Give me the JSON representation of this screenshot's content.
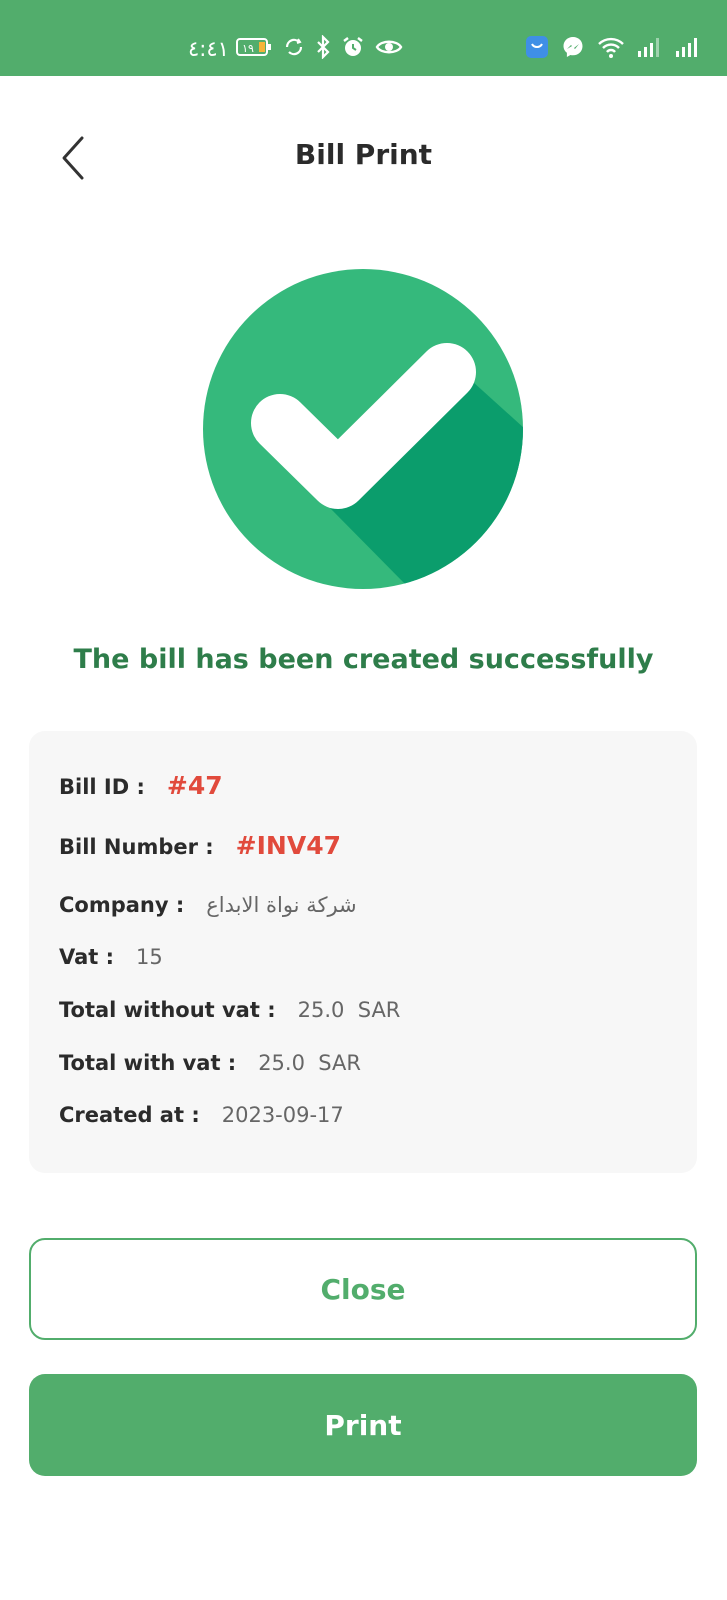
{
  "status_bar": {
    "time": "٤:٤١",
    "battery_level": "١٩",
    "icons_left": [
      "battery-icon",
      "sync-icon",
      "bluetooth-icon",
      "alarm-icon",
      "eye-icon"
    ],
    "icons_right": [
      "app-icon",
      "messenger-icon",
      "wifi-icon",
      "signal-icon",
      "signal-icon"
    ],
    "background_color": "#52ad6c"
  },
  "header": {
    "title": "Bill Print",
    "back_icon": "chevron-left-icon"
  },
  "success": {
    "icon": "check-circle-icon",
    "message": "The bill has been created successfully",
    "icon_color": "#35b97c",
    "icon_shadow_color": "#0b9d6c"
  },
  "details": {
    "bill_id": {
      "label": "Bill ID :",
      "value": "#47"
    },
    "bill_number": {
      "label": "Bill Number :",
      "value": "#INV47"
    },
    "company": {
      "label": "Company :",
      "value": "شركة نواة الابداع"
    },
    "vat": {
      "label": "Vat :",
      "value": "15"
    },
    "total_without_vat": {
      "label": "Total without vat :",
      "value": "25.0  SAR"
    },
    "total_with_vat": {
      "label": "Total with vat :",
      "value": "25.0  SAR"
    },
    "created_at": {
      "label": "Created at :",
      "value": "2023-09-17"
    }
  },
  "actions": {
    "close_label": "Close",
    "print_label": "Print"
  },
  "colors": {
    "primary": "#52ad6c",
    "accent": "#e14a3c",
    "success_text": "#2e7d4a"
  }
}
